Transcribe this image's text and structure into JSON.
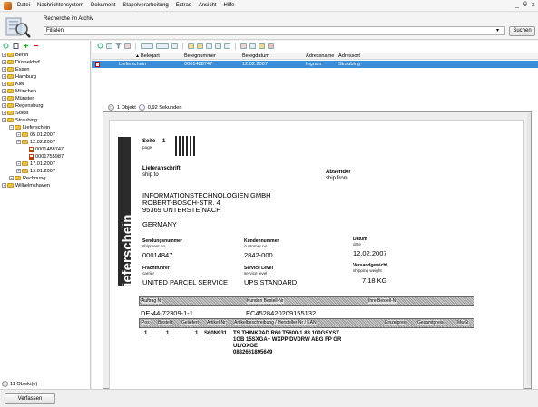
{
  "menu": {
    "items": [
      "Datei",
      "Nachrichtensystem",
      "Dokument",
      "Stapelverarbeitung",
      "Extras",
      "Ansicht",
      "Hilfe"
    ],
    "win_min": "_",
    "win_max": "θ",
    "win_close": "x"
  },
  "search": {
    "title": "Recherche im Archiv",
    "value": "Filialen",
    "button": "Suchen",
    "dropdown": "▾"
  },
  "tree": {
    "nodes": [
      "Berlin",
      "Düsseldorf",
      "Essen",
      "Hamburg",
      "Kiel",
      "München",
      "Münster",
      "Regensburg",
      "Soest",
      "Straubing",
      "Lieferschein",
      "05.01.2007",
      "12.02.2007",
      "0001488747",
      "0001755987",
      "17.01.2007",
      "19.01.2007",
      "Rechnung",
      "Wilhelmshaven"
    ],
    "status": "11 Objekt(e)"
  },
  "grid": {
    "columns": [
      "Belegart",
      "Belegnummer",
      "Belegdatum",
      "Adressname",
      "Adressort"
    ],
    "sort_indicator": "▲",
    "row": {
      "belegart": "Lieferschein",
      "belegnummer": "0001488747",
      "belegdatum": "12.02.2007",
      "adressname": "Ingram",
      "adressort": "Straubing"
    },
    "status_count": "1 Objekt",
    "status_time": "0,92 Sekunden"
  },
  "doc": {
    "vertical_title": "Lieferschein",
    "seite": "Seite",
    "page": "page",
    "page_num": "1",
    "lieferanschrift": "Lieferanschrift",
    "ship_to": "ship to",
    "absender": "Absender",
    "ship_from": "ship from",
    "addr1": "INFORMATIONSTECHNOLOGIEN GMBH",
    "addr2": "ROBERT-BOSCH-STR. 4",
    "addr3": "95369 UNTERSTEINACH",
    "country": "GERMANY",
    "sendung_label": "Sendungsnummer",
    "sendung_sub": "shipment no",
    "sendung_val": "00014847",
    "kunden_label": "Kundennummer",
    "kunden_sub": "customer no",
    "kunden_val": "2842-000",
    "datum_label": "Datum",
    "datum_sub": "date",
    "datum_val": "12.02.2007",
    "fracht_label": "Frachtführer",
    "fracht_sub": "carrier",
    "fracht_val": "UNITED PARCEL SERVICE",
    "service_label": "Service Level",
    "service_sub": "service level",
    "service_val": "UPS STANDARD",
    "gewicht_label": "Versandgewicht",
    "gewicht_sub": "shipping weight",
    "gewicht_val": "7,18 KG",
    "auftrag_hdr": "Auftrag Nr",
    "kbest_hdr": "Kunden Bestell-Nr",
    "ibest_hdr": "Ihre Bestell-Nr",
    "auftrag_val": "DE-44-72309-1-1",
    "kbest_val": "EC4528420209155132",
    "pos_hdr": "Pos",
    "bestellt_hdr": "Bestellt",
    "geliefert_hdr": "Geliefert",
    "artikel_hdr": "Artikel-Nr",
    "beschr_hdr": "Artikelbeschreibung / Hersteller Nr / EAN",
    "einzel_hdr": "Einzelpreis",
    "gesamt_hdr": "Gesamtpreis",
    "mwst_hdr": "MwSt",
    "item_pos": "1",
    "item_best": "1",
    "item_gel": "1",
    "item_art": "S60N931",
    "item_desc1": "TS THINKPAD R60 T5600-1.83 100GSYST",
    "item_desc2": "1GB 15SXGA+ WXPP DVDRW ABG FP GR",
    "item_desc3": "UL/OXGE",
    "item_ean": "0882661895649"
  },
  "footer": {
    "button": "Verfassen"
  }
}
